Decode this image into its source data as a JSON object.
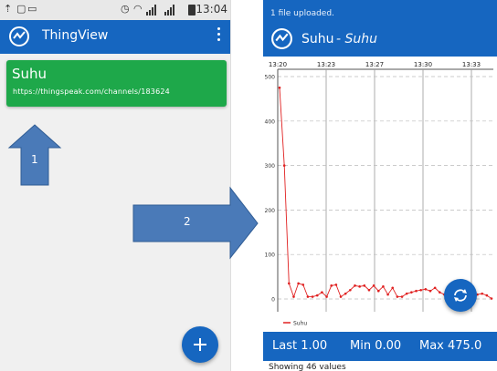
{
  "left_screen": {
    "status_bar": {
      "time": "13:04"
    },
    "app_bar": {
      "title": "ThingView",
      "menu_icon": "more-vert-icon"
    },
    "channel_card": {
      "name": "Suhu",
      "url": "https://thingspeak.com/channels/183624",
      "color": "#1ea84a"
    },
    "fab": {
      "icon": "plus-icon"
    }
  },
  "annotations": {
    "arrow1_label": "1",
    "arrow2_label": "2",
    "color": "#4a7ab8"
  },
  "right_screen": {
    "status_bar": {
      "notification": "1 file uploaded."
    },
    "app_bar": {
      "title": "Suhu",
      "subtitle": "- Suhu"
    },
    "stats": {
      "last": "Last 1.00",
      "min": "Min 0.00",
      "max": "Max 475.0"
    },
    "showing": "Showing 46 values",
    "fab": {
      "icon": "refresh-icon"
    }
  },
  "chart_data": {
    "type": "line",
    "title": "",
    "xlabel": "",
    "ylabel": "",
    "x_ticks": [
      "13:20",
      "13:23",
      "13:27",
      "13:30",
      "13:33"
    ],
    "y_ticks": [
      "0",
      "100",
      "200",
      "300",
      "400",
      "500"
    ],
    "ylim": [
      0,
      500
    ],
    "legend": "bottom-left",
    "series": [
      {
        "name": "Suhu",
        "color": "#e02020",
        "values": [
          475,
          300,
          35,
          5,
          35,
          32,
          5,
          5,
          8,
          15,
          5,
          30,
          32,
          5,
          12,
          20,
          30,
          28,
          30,
          20,
          30,
          18,
          28,
          10,
          25,
          5,
          5,
          12,
          15,
          18,
          20,
          22,
          18,
          25,
          15,
          10,
          5,
          3,
          2,
          3,
          5,
          8,
          10,
          12,
          8,
          1
        ]
      }
    ]
  },
  "colors": {
    "primary": "#1666c0",
    "card_green": "#1ea84a",
    "line": "#e02020"
  }
}
